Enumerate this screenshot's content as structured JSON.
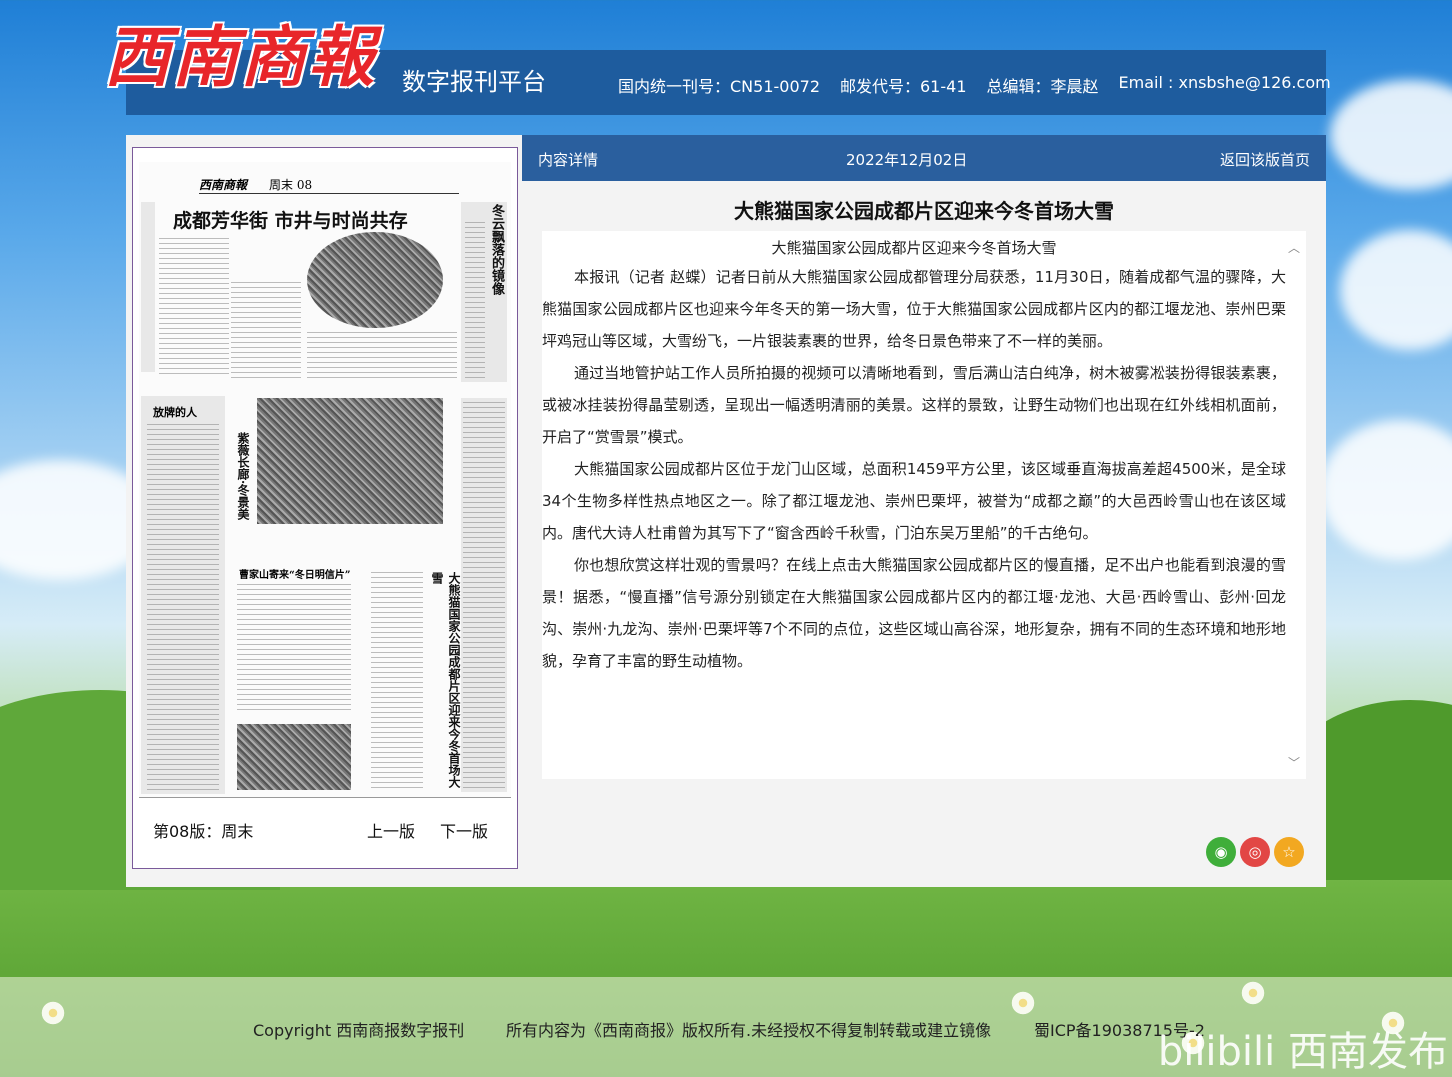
{
  "header": {
    "logo_text": "西南商報",
    "platform": "数字报刊平台",
    "info": [
      "国内统一刊号：CN51-0072",
      "邮发代号：61-41",
      "总编辑：李晨赵",
      "Email : xnsbshe@126.com"
    ]
  },
  "paper_preview": {
    "masthead_logo": "西南商報",
    "masthead_page": "周末 08",
    "headline": "成都芳华街 市井与时尚共存",
    "vertical_titles": [
      "冬云飘落的镜像",
      "紫薇长廊·冬景美",
      "大熊猫国家公园成都片区迎来今冬首场大雪"
    ],
    "section_heads": [
      "放牌的人",
      "曹家山寄来“冬日明信片”"
    ]
  },
  "page_nav": {
    "label": "第08版：周末",
    "prev": "上一版",
    "next": "下一版"
  },
  "info_bar": {
    "label": "内容详情",
    "date": "2022年12月02日",
    "back": "返回该版首页"
  },
  "article": {
    "title": "大熊猫国家公园成都片区迎来今冬首场大雪",
    "subtitle": "大熊猫国家公园成都片区迎来今冬首场大雪",
    "paragraphs": [
      "本报讯（记者 赵蝶）记者日前从大熊猫国家公园成都管理分局获悉，11月30日，随着成都气温的骤降，大熊猫国家公园成都片区也迎来今年冬天的第一场大雪，位于大熊猫国家公园成都片区内的都江堰龙池、崇州巴栗坪鸡冠山等区域，大雪纷飞，一片银装素裹的世界，给冬日景色带来了不一样的美丽。",
      "通过当地管护站工作人员所拍摄的视频可以清晰地看到，雪后满山洁白纯净，树木被雾凇装扮得银装素裹，或被冰挂装扮得晶莹剔透，呈现出一幅透明清丽的美景。这样的景致，让野生动物们也出现在红外线相机面前，开启了“赏雪景”模式。",
      "大熊猫国家公园成都片区位于龙门山区域，总面积1459平方公里，该区域垂直海拔高差超4500米，是全球34个生物多样性热点地区之一。除了都江堰龙池、崇州巴栗坪，被誉为“成都之巅”的大邑西岭雪山也在该区域内。唐代大诗人杜甫曾为其写下了“窗含西岭千秋雪，门泊东吴万里船”的千古绝句。",
      "你也想欣赏这样壮观的雪景吗？在线上点击大熊猫国家公园成都片区的慢直播，足不出户也能看到浪漫的雪景！据悉，“慢直播”信号源分别锁定在大熊猫国家公园成都片区内的都江堰·龙池、大邑·西岭雪山、彭州·回龙沟、崇州·九龙沟、崇州·巴栗坪等7个不同的点位，这些区域山高谷深，地形复杂，拥有不同的生态环境和地形地貌，孕育了丰富的野生动植物。"
    ]
  },
  "share": {
    "wechat_icon": "wechat-icon",
    "weibo_icon": "weibo-icon",
    "favorite_icon": "star-icon"
  },
  "footer": {
    "copyright": "Copyright 西南商报数字报刊",
    "rights": "所有内容为《西南商报》版权所有.未经授权不得复制转载或建立镜像",
    "icp": "蜀ICP备19038715号-2",
    "watermark": "bilibili 西南发布"
  },
  "colors": {
    "header_bar": "#1e5c9e",
    "info_bar": "#2a5f9e",
    "logo_red": "#e8262a"
  }
}
